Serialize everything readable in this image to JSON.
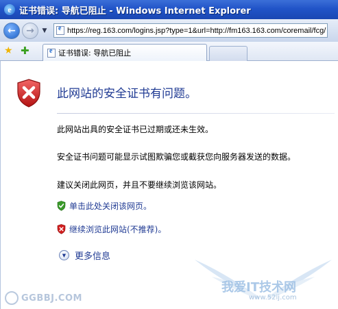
{
  "window": {
    "title": "证书错误: 导航已阻止 - Windows Internet Explorer"
  },
  "navbar": {
    "address_url": "https://reg.163.com/logins.jsp?type=1&url=http://fm163.163.com/coremail/fcg/"
  },
  "tabs": [
    {
      "label": "证书错误: 导航已阻止"
    }
  ],
  "page": {
    "headline": "此网站的安全证书有问题。",
    "paragraph_1": "此网站出具的安全证书已过期或还未生效。",
    "paragraph_2": "安全证书问题可能显示试图欺骗您或截获您向服务器发送的数据。",
    "paragraph_3": "建议关闭此网页，并且不要继续浏览该网站。",
    "action_close": "单击此处关闭该网页。",
    "action_continue": "继续浏览此网站(不推荐)。",
    "more_info": "更多信息"
  },
  "watermarks": {
    "left_text": "GGBBJ.COM",
    "right_text": "我爱IT技术网",
    "right_url": "www.52ij.com"
  },
  "colors": {
    "titlebar": "#2154c8",
    "link": "#1f3a93",
    "error_red": "#d21f1f",
    "safe_green": "#3a9a2a"
  },
  "icons": {
    "back": "back-arrow-icon",
    "forward": "forward-arrow-icon",
    "error_shield": "red-shield-x-icon",
    "green_shield": "green-shield-check-icon",
    "red_shield": "red-shield-x-icon",
    "more_info": "chevron-down-circle-icon"
  }
}
